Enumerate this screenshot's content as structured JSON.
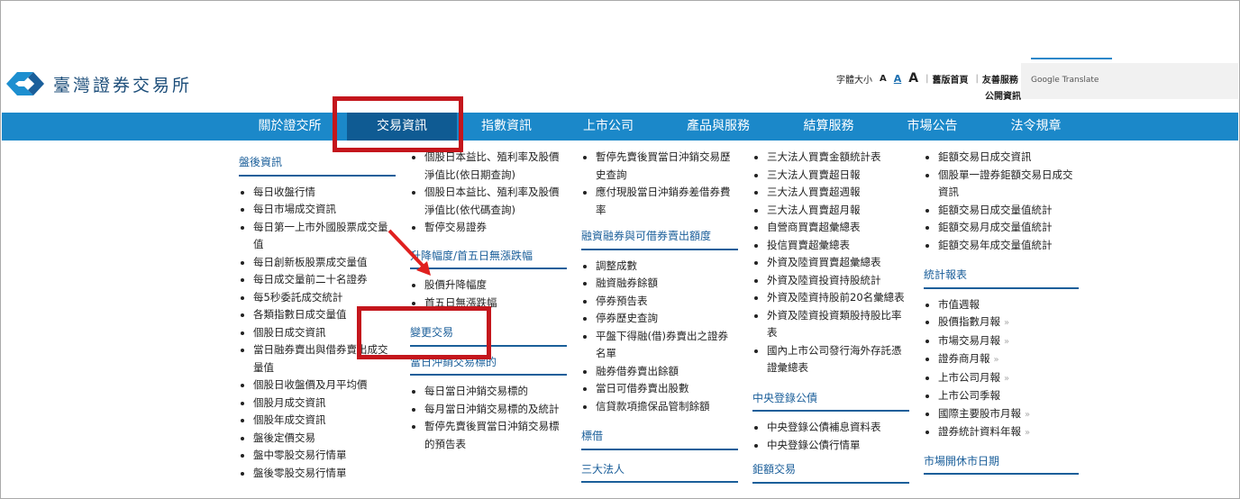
{
  "header": {
    "site_name": "臺灣證券交易所",
    "font_size_label": "字體大小",
    "font_a1": "A",
    "font_a2": "A",
    "font_a3": "A",
    "simple_home": "舊版首頁",
    "friendly_service": "友善服務",
    "public_info": "公開資訊",
    "translate_label": "Google Translate"
  },
  "nav": {
    "items": [
      "關於證交所",
      "交易資訊",
      "指數資訊",
      "上市公司",
      "產品與服務",
      "結算服務",
      "市場公告",
      "法令規章"
    ],
    "active": "交易資訊"
  },
  "menu": {
    "col1": {
      "title": "盤後資訊",
      "items": [
        "每日收盤行情",
        "每日市場成交資訊",
        "每日第一上市外國股票成交量值",
        "每日創新板股票成交量值",
        "每日成交量前二十名證券",
        "每5秒委託成交統計",
        "各類指數日成交量值",
        "個股日成交資訊",
        "當日融券賣出與借券賣出成交量值",
        "個股日收盤價及月平均價",
        "個股月成交資訊",
        "個股年成交資訊",
        "盤後定價交易",
        "盤中零股交易行情單",
        "盤後零股交易行情單"
      ]
    },
    "col2": {
      "items_top": [
        "個股日本益比、殖利率及股價淨值比(依日期查詢)",
        "個股日本益比、殖利率及股價淨值比(依代碼查詢)",
        "暫停交易證券"
      ],
      "section_price": "升降幅度/首五日無漲跌幅",
      "items_price": [
        "股價升降幅度",
        "首五日無漲跌幅"
      ],
      "section_change": "變更交易",
      "section_daytrade": "當日沖銷交易標的",
      "items_daytrade": [
        "每日當日沖銷交易標的",
        "每月當日沖銷交易標的及統計",
        "暫停先賣後買當日沖銷交易標的預告表"
      ]
    },
    "col3": {
      "items_top": [
        "暫停先賣後買當日沖銷交易歷史查詢",
        "應付現股當日沖銷券差借券費率"
      ],
      "section_margin": "融資融券與可借券賣出額度",
      "items_margin": [
        "調整成數",
        "融資融券餘額",
        "停券預告表",
        "停券歷史查詢",
        "平盤下得融(借)券賣出之證券名單",
        "融券借券賣出餘額",
        "當日可借券賣出股數",
        "信貸款項擔保品管制餘額"
      ],
      "section_lending": "標借",
      "section_inst": "三大法人"
    },
    "col4": {
      "items_top": [
        "三大法人買賣金額統計表",
        "三大法人買賣超日報",
        "三大法人買賣超週報",
        "三大法人買賣超月報",
        "自營商買賣超彙總表",
        "投信買賣超彙總表",
        "外資及陸資買賣超彙總表",
        "外資及陸資投資持股統計",
        "外資及陸資持股前20名彙總表",
        "外資及陸資投資類股持股比率表",
        "國內上市公司發行海外存託憑證彙總表"
      ],
      "section_bond": "中央登錄公債",
      "items_bond": [
        "中央登錄公債補息資料表",
        "中央登錄公債行情單"
      ],
      "section_block": "鉅額交易"
    },
    "col5": {
      "items_top": [
        "鉅額交易日成交資訊",
        "個股單一證券鉅額交易日成交資訊",
        "鉅額交易日成交量值統計",
        "鉅額交易月成交量值統計",
        "鉅額交易年成交量值統計"
      ],
      "section_stats": "統計報表",
      "items_stats": [
        "市值週報",
        "股價指數月報",
        "市場交易月報",
        "證券商月報",
        "上市公司月報",
        "上市公司季報",
        "國際主要股市月報",
        "證券統計資料年報"
      ],
      "section_holiday": "市場開休市日期"
    }
  }
}
